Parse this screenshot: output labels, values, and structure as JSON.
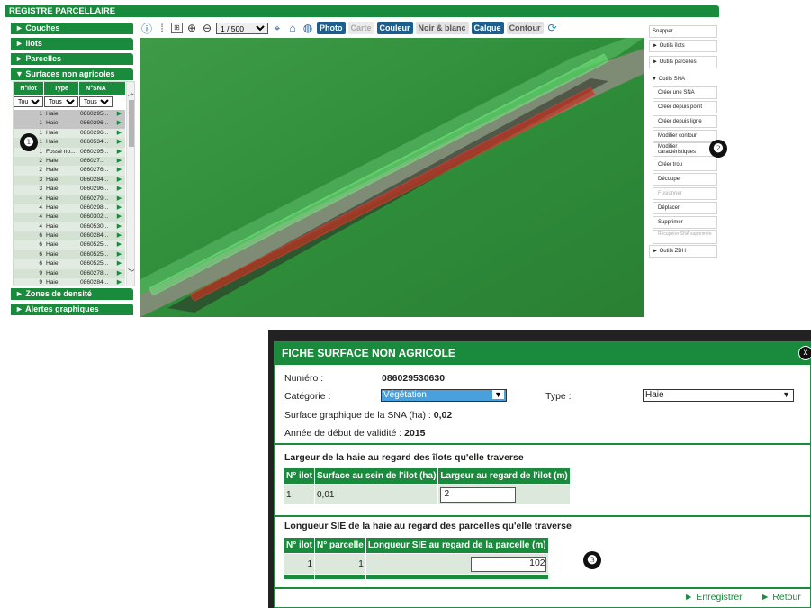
{
  "app_title": "REGISTRE PARCELLAIRE",
  "sections": {
    "couches": "Couches",
    "ilots": "Ilots",
    "parcelles": "Parcelles",
    "sna": "Surfaces non agricoles",
    "zones": "Zones de densité homogène",
    "alertes": "Alertes graphiques"
  },
  "sna_table": {
    "headers": [
      "N°Ilot",
      "Type",
      "N°SNA"
    ],
    "filters": [
      "Tous",
      "Tous",
      "Tous"
    ],
    "rows": [
      {
        "ilot": "1",
        "type": "Haie",
        "sna": "0860295..."
      },
      {
        "ilot": "1",
        "type": "Haie",
        "sna": "0860296..."
      },
      {
        "ilot": "1",
        "type": "Haie",
        "sna": "0860296..."
      },
      {
        "ilot": "1",
        "type": "Haie",
        "sna": "0860534..."
      },
      {
        "ilot": "1",
        "type": "Fossé no...",
        "sna": "0860295..."
      },
      {
        "ilot": "2",
        "type": "Haie",
        "sna": "086027..."
      },
      {
        "ilot": "2",
        "type": "Haie",
        "sna": "0860276..."
      },
      {
        "ilot": "3",
        "type": "Haie",
        "sna": "0860284..."
      },
      {
        "ilot": "3",
        "type": "Haie",
        "sna": "0860296..."
      },
      {
        "ilot": "4",
        "type": "Haie",
        "sna": "0860279..."
      },
      {
        "ilot": "4",
        "type": "Haie",
        "sna": "0860298..."
      },
      {
        "ilot": "4",
        "type": "Haie",
        "sna": "0860302..."
      },
      {
        "ilot": "4",
        "type": "Haie",
        "sna": "0860530..."
      },
      {
        "ilot": "6",
        "type": "Haie",
        "sna": "0860284..."
      },
      {
        "ilot": "6",
        "type": "Haie",
        "sna": "0860525..."
      },
      {
        "ilot": "6",
        "type": "Haie",
        "sna": "0860525..."
      },
      {
        "ilot": "6",
        "type": "Haie",
        "sna": "0860525..."
      },
      {
        "ilot": "9",
        "type": "Haie",
        "sna": "0860278..."
      },
      {
        "ilot": "9",
        "type": "Haie",
        "sna": "0860284..."
      }
    ]
  },
  "markers": [
    "❶",
    "❷",
    "❸"
  ],
  "toolbar": {
    "scale": "1 / 500",
    "photo": "Photo",
    "carte": "Carte",
    "couleur": "Couleur",
    "noir_blanc": "Noir & blanc",
    "calque": "Calque",
    "contour": "Contour",
    "icons": [
      "info-icon",
      "measure-icon",
      "scale-icon",
      "zoom-in-icon",
      "zoom-out-icon",
      "locate-icon",
      "home-icon",
      "globe-icon",
      "refresh-icon"
    ]
  },
  "tools": {
    "snapper": "Snapper",
    "outils_ilots": "► Outils îlots",
    "outils_parcelles": "► Outils parcelles",
    "outils_sna": "▼ Outils SNA",
    "creer_sna": "Créer une SNA",
    "creer_point": "Créer depuis point",
    "creer_ligne": "Créer depuis ligne",
    "modifier_contour": "Modifier contour",
    "modifier_carac": "Modifier caractéristiques",
    "creer_trou": "Créer trou",
    "decouper": "Découper",
    "fusionner": "Fusionner",
    "deplacer": "Déplacer",
    "supprimer": "Supprimer",
    "recuperer": "Récupérer SNA supprimée",
    "outils_zdh": "► Outils ZDH"
  },
  "dialog": {
    "title": "FICHE SURFACE NON AGRICOLE",
    "close": "x",
    "numero_label": "Numéro :",
    "numero": "086029530630",
    "categorie_label": "Catégorie :",
    "categorie": "Végétation",
    "type_label": "Type :",
    "type": "Haie",
    "surface_label": "Surface graphique de la SNA (ha) :",
    "surface": "0,02",
    "annee_label": "Année de début de validité :",
    "annee": "2015",
    "largeur_title": "Largeur de la haie au regard des îlots qu'elle traverse",
    "largeur_headers": [
      "N° ilot",
      "Surface au sein de l'ilot (ha)",
      "Largeur au regard de l'ilot (m)"
    ],
    "largeur_row": {
      "ilot": "1",
      "surface": "0,01",
      "largeur": "2"
    },
    "longueur_title": "Longueur SIE de la haie au regard des parcelles qu'elle traverse",
    "longueur_headers": [
      "N° ilot",
      "N° parcelle",
      "Longueur SIE au regard de la parcelle (m)"
    ],
    "longueur_row": {
      "ilot": "1",
      "parcelle": "1",
      "longueur": "102"
    },
    "enregistrer": "► Enregistrer",
    "retour": "► Retour"
  }
}
